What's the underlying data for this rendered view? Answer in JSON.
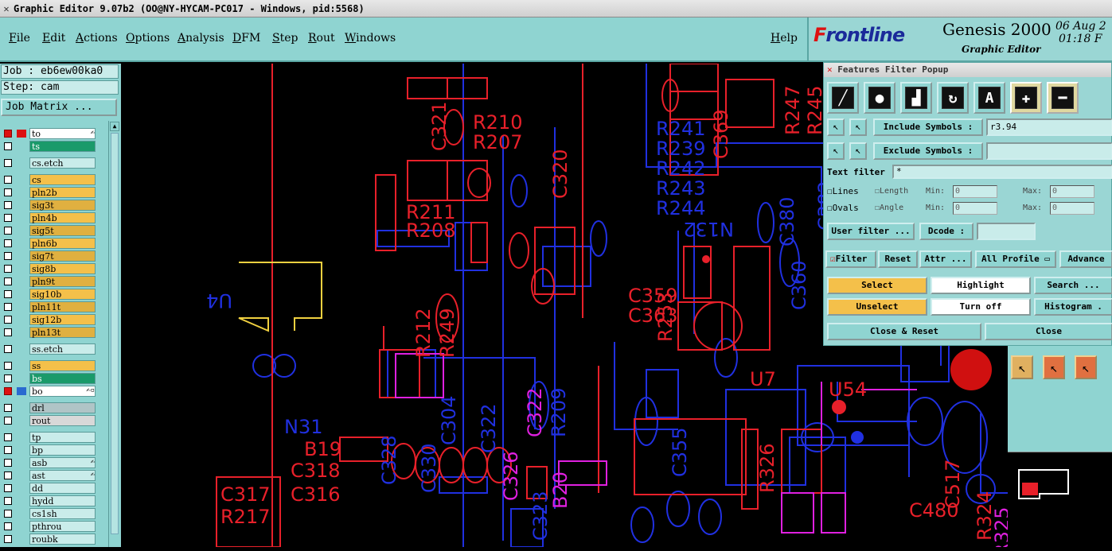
{
  "window": {
    "title": "Graphic Editor 9.07b2 (OO@NY-HYCAM-PC017 - Windows, pid:5568)"
  },
  "menu": {
    "items": [
      "File",
      "Edit",
      "Actions",
      "Options",
      "Analysis",
      "DFM",
      "Step",
      "Rout",
      "Windows"
    ],
    "help": "Help"
  },
  "brand": {
    "logo_left": "F",
    "logo_rest": "rontline",
    "product": "Genesis 2000",
    "subtitle": "Graphic Editor",
    "date": "06 Aug 2",
    "time": "01:18 F"
  },
  "left": {
    "job": "Job : eb6ew00ka0",
    "step": "Step: cam",
    "job_matrix": "Job Matrix ...",
    "layers": [
      {
        "name": "to",
        "bg": "#ffffff",
        "box": "red",
        "sq": "#d11",
        "mark": "✍"
      },
      {
        "name": "ts",
        "bg": "#1a9a6a",
        "box": "white",
        "sq": "",
        "mark": ""
      },
      {
        "gap": true
      },
      {
        "name": "cs.etch",
        "bg": "#c9ecea",
        "box": "white",
        "sq": "",
        "mark": ""
      },
      {
        "gap": true
      },
      {
        "name": "cs",
        "bg": "#f4c04a",
        "box": "white",
        "sq": "",
        "mark": ""
      },
      {
        "name": "pln2b",
        "bg": "#f4c04a",
        "box": "white",
        "sq": "",
        "mark": ""
      },
      {
        "name": "sig3t",
        "bg": "#e0b040",
        "box": "white",
        "sq": "",
        "mark": ""
      },
      {
        "name": "pln4b",
        "bg": "#f4c04a",
        "box": "white",
        "sq": "",
        "mark": ""
      },
      {
        "name": "sig5t",
        "bg": "#e0b040",
        "box": "white",
        "sq": "",
        "mark": ""
      },
      {
        "name": "pln6b",
        "bg": "#f4c04a",
        "box": "white",
        "sq": "",
        "mark": ""
      },
      {
        "name": "sig7t",
        "bg": "#e0b040",
        "box": "white",
        "sq": "",
        "mark": ""
      },
      {
        "name": "sig8b",
        "bg": "#f4c04a",
        "box": "white",
        "sq": "",
        "mark": ""
      },
      {
        "name": "pln9t",
        "bg": "#e0b040",
        "box": "white",
        "sq": "",
        "mark": ""
      },
      {
        "name": "sig10b",
        "bg": "#f4c04a",
        "box": "white",
        "sq": "",
        "mark": ""
      },
      {
        "name": "pln11t",
        "bg": "#e0b040",
        "box": "white",
        "sq": "",
        "mark": ""
      },
      {
        "name": "sig12b",
        "bg": "#f4c04a",
        "box": "white",
        "sq": "",
        "mark": ""
      },
      {
        "name": "pln13t",
        "bg": "#e0b040",
        "box": "white",
        "sq": "",
        "mark": ""
      },
      {
        "gap": true
      },
      {
        "name": "ss.etch",
        "bg": "#c9ecea",
        "box": "white",
        "sq": "",
        "mark": ""
      },
      {
        "gap": true
      },
      {
        "name": "ss",
        "bg": "#f4c04a",
        "box": "white",
        "sq": "",
        "mark": ""
      },
      {
        "name": "bs",
        "bg": "#1a9a6a",
        "box": "white",
        "sq": "",
        "mark": ""
      },
      {
        "name": "bo",
        "bg": "#ffffff",
        "box": "red",
        "sq": "#2a6ad0",
        "mark": "✍▫"
      },
      {
        "gap": true
      },
      {
        "name": "drl",
        "bg": "#b0c4c6",
        "box": "white",
        "sq": "",
        "mark": ""
      },
      {
        "name": "rout",
        "bg": "#d8d8d8",
        "box": "white",
        "sq": "",
        "mark": ""
      },
      {
        "gap": true
      },
      {
        "name": "tp",
        "bg": "#c9ecea",
        "box": "white",
        "sq": "",
        "mark": ""
      },
      {
        "name": "bp",
        "bg": "#c9ecea",
        "box": "white",
        "sq": "",
        "mark": ""
      },
      {
        "name": "asb",
        "bg": "#c9ecea",
        "box": "white",
        "sq": "",
        "mark": "✍"
      },
      {
        "name": "ast",
        "bg": "#c9ecea",
        "box": "white",
        "sq": "",
        "mark": "✍"
      },
      {
        "name": "dd",
        "bg": "#c9ecea",
        "box": "white",
        "sq": "",
        "mark": ""
      },
      {
        "name": "hydd",
        "bg": "#c9ecea",
        "box": "white",
        "sq": "",
        "mark": ""
      },
      {
        "name": "cs1sh",
        "bg": "#c9ecea",
        "box": "white",
        "sq": "",
        "mark": ""
      },
      {
        "name": "pthrou",
        "bg": "#c9ecea",
        "box": "white",
        "sq": "",
        "mark": ""
      },
      {
        "name": "roubk",
        "bg": "#c9ecea",
        "box": "white",
        "sq": "",
        "mark": ""
      }
    ]
  },
  "popup": {
    "title": "Features Filter Popup",
    "tools": [
      "line-tool",
      "pad-tool",
      "surface-tool",
      "arc-tool",
      "text-tool",
      "plus-tool",
      "minus-tool"
    ],
    "include_label": "Include Symbols :",
    "include_value": "r3.94",
    "exclude_label": "Exclude Symbols :",
    "exclude_value": "",
    "text_filter_label": "Text filter",
    "text_filter_value": "*",
    "lines": "Lines",
    "ovals": "Ovals",
    "length": "Length",
    "angle": "Angle",
    "min": "Min:",
    "max": "Max:",
    "zero": "0",
    "user_filter": "User filter ...",
    "dcode": "Dcode :",
    "filter": "Filter",
    "reset": "Reset",
    "attr": "Attr ...",
    "all_profile": "All Profile",
    "advanced": "Advance",
    "select": "Select",
    "highlight": "Highlight",
    "search": "Search ...",
    "unselect": "Unselect",
    "turn_off": "Turn off",
    "histogram": "Histogram .",
    "close_reset": "Close & Reset",
    "close": "Close"
  },
  "colors": {
    "red": "#e8202a",
    "blue": "#2030e0",
    "magenta": "#e020e0",
    "yellow": "#f0d040"
  }
}
